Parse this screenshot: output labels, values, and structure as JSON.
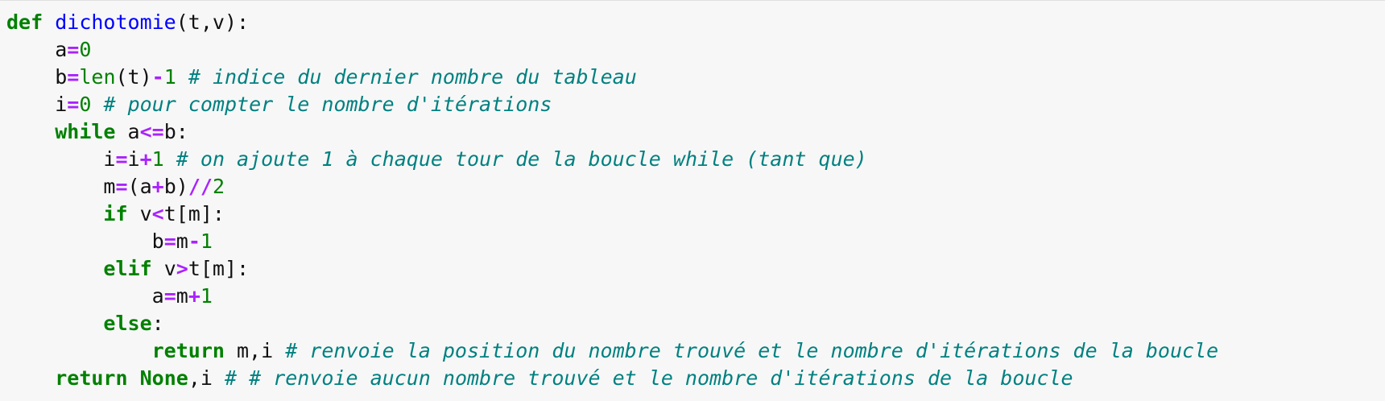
{
  "code_cell": {
    "language": "python",
    "colors": {
      "background": "#f7f7f7",
      "keyword": "#008000",
      "function_name": "#0000ff",
      "operator": "#aa22ff",
      "number": "#008000",
      "builtin": "#008000",
      "comment": "#008080",
      "text": "#111111"
    },
    "lines": [
      {
        "indent": 0,
        "tokens": [
          {
            "t": "def",
            "k": "kw"
          },
          {
            "t": " ",
            "k": "tx"
          },
          {
            "t": "dichotomie",
            "k": "fn"
          },
          {
            "t": "(t,v):",
            "k": "tx"
          }
        ]
      },
      {
        "indent": 4,
        "tokens": [
          {
            "t": "a",
            "k": "tx"
          },
          {
            "t": "=",
            "k": "op"
          },
          {
            "t": "0",
            "k": "num"
          }
        ]
      },
      {
        "indent": 4,
        "tokens": [
          {
            "t": "b",
            "k": "tx"
          },
          {
            "t": "=",
            "k": "op"
          },
          {
            "t": "len",
            "k": "bi"
          },
          {
            "t": "(t)",
            "k": "tx"
          },
          {
            "t": "-",
            "k": "op"
          },
          {
            "t": "1",
            "k": "num"
          },
          {
            "t": " ",
            "k": "tx"
          },
          {
            "t": "# indice du dernier nombre du tableau",
            "k": "cm"
          }
        ]
      },
      {
        "indent": 4,
        "tokens": [
          {
            "t": "i",
            "k": "tx"
          },
          {
            "t": "=",
            "k": "op"
          },
          {
            "t": "0",
            "k": "num"
          },
          {
            "t": " ",
            "k": "tx"
          },
          {
            "t": "# pour compter le nombre d'itérations",
            "k": "cm"
          }
        ]
      },
      {
        "indent": 4,
        "tokens": [
          {
            "t": "while",
            "k": "kw"
          },
          {
            "t": " a",
            "k": "tx"
          },
          {
            "t": "<=",
            "k": "op"
          },
          {
            "t": "b:",
            "k": "tx"
          }
        ]
      },
      {
        "indent": 8,
        "tokens": [
          {
            "t": "i",
            "k": "tx"
          },
          {
            "t": "=",
            "k": "op"
          },
          {
            "t": "i",
            "k": "tx"
          },
          {
            "t": "+",
            "k": "op"
          },
          {
            "t": "1",
            "k": "num"
          },
          {
            "t": " ",
            "k": "tx"
          },
          {
            "t": "# on ajoute 1 à chaque tour de la boucle while (tant que)",
            "k": "cm"
          }
        ]
      },
      {
        "indent": 8,
        "tokens": [
          {
            "t": "m",
            "k": "tx"
          },
          {
            "t": "=",
            "k": "op"
          },
          {
            "t": "(a",
            "k": "tx"
          },
          {
            "t": "+",
            "k": "op"
          },
          {
            "t": "b)",
            "k": "tx"
          },
          {
            "t": "//",
            "k": "op"
          },
          {
            "t": "2",
            "k": "num"
          }
        ]
      },
      {
        "indent": 8,
        "tokens": [
          {
            "t": "if",
            "k": "kw"
          },
          {
            "t": " v",
            "k": "tx"
          },
          {
            "t": "<",
            "k": "op"
          },
          {
            "t": "t[m]:",
            "k": "tx"
          }
        ]
      },
      {
        "indent": 12,
        "tokens": [
          {
            "t": "b",
            "k": "tx"
          },
          {
            "t": "=",
            "k": "op"
          },
          {
            "t": "m",
            "k": "tx"
          },
          {
            "t": "-",
            "k": "op"
          },
          {
            "t": "1",
            "k": "num"
          }
        ]
      },
      {
        "indent": 8,
        "tokens": [
          {
            "t": "elif",
            "k": "kw"
          },
          {
            "t": " v",
            "k": "tx"
          },
          {
            "t": ">",
            "k": "op"
          },
          {
            "t": "t[m]:",
            "k": "tx"
          }
        ]
      },
      {
        "indent": 12,
        "tokens": [
          {
            "t": "a",
            "k": "tx"
          },
          {
            "t": "=",
            "k": "op"
          },
          {
            "t": "m",
            "k": "tx"
          },
          {
            "t": "+",
            "k": "op"
          },
          {
            "t": "1",
            "k": "num"
          }
        ]
      },
      {
        "indent": 8,
        "tokens": [
          {
            "t": "else",
            "k": "kw"
          },
          {
            "t": ":",
            "k": "tx"
          }
        ]
      },
      {
        "indent": 12,
        "tokens": [
          {
            "t": "return",
            "k": "kw"
          },
          {
            "t": " m,i",
            "k": "tx"
          },
          {
            "t": " ",
            "k": "tx"
          },
          {
            "t": "# renvoie la position du nombre trouvé et le nombre d'itérations de la boucle",
            "k": "cm"
          }
        ]
      },
      {
        "indent": 4,
        "tokens": [
          {
            "t": "return",
            "k": "kw"
          },
          {
            "t": " ",
            "k": "tx"
          },
          {
            "t": "None",
            "k": "kw"
          },
          {
            "t": ",i",
            "k": "tx"
          },
          {
            "t": " ",
            "k": "tx"
          },
          {
            "t": "# # renvoie aucun nombre trouvé et le nombre d'itérations de la boucle",
            "k": "cm"
          }
        ]
      }
    ]
  }
}
